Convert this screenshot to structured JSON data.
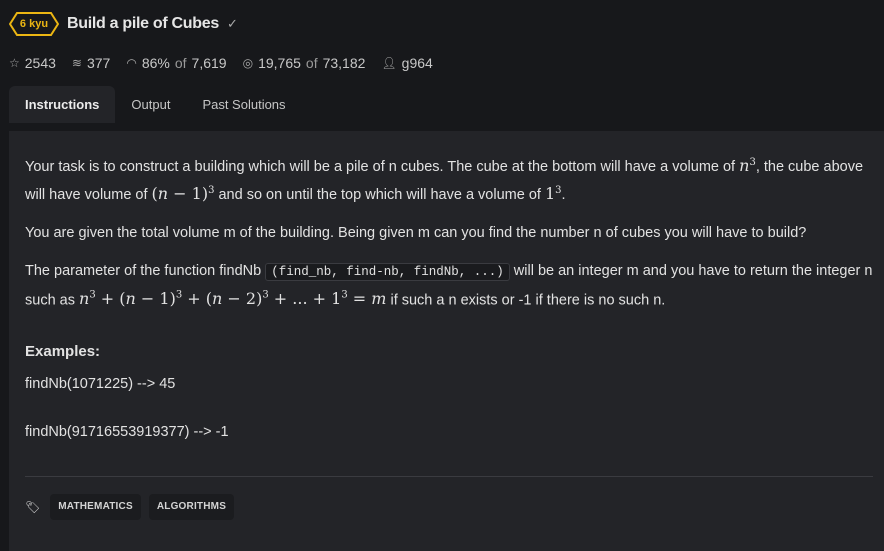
{
  "kata": {
    "rank": "6 kyu",
    "title": "Build a pile of Cubes",
    "rank_color": "#ecb613"
  },
  "stats": {
    "stars": "2543",
    "collections": "377",
    "satisfaction": "86%",
    "satisfaction_of_label": "of",
    "votes": "7,619",
    "completed": "19,765",
    "completed_of_label": "of",
    "attempts": "73,182",
    "author": "g964"
  },
  "tabs": [
    {
      "label": "Instructions"
    },
    {
      "label": "Output"
    },
    {
      "label": "Past Solutions"
    }
  ],
  "description": {
    "p1a": "Your task is to construct a building which will be a pile of n cubes. The cube at the bottom will have a volume of ",
    "p1b": ", the cube above will have volume of ",
    "p1c": " and so on until the top which will have a volume of ",
    "p2": "You are given the total volume m of the building. Being given m can you find the number n of cubes you will have to build?",
    "p3a": "The parameter of the function findNb ",
    "p3code": "(find_nb, find-nb, findNb, ...)",
    "p3b": " will be an integer m and you have to return the integer n such as ",
    "p3c": " if such a n exists or -1 if there is no such n.",
    "examples_heading": "Examples:",
    "example1": "findNb(1071225) --> 45",
    "example2": "findNb(91716553919377) --> -1"
  },
  "tags": [
    "MATHEMATICS",
    "ALGORITHMS"
  ]
}
